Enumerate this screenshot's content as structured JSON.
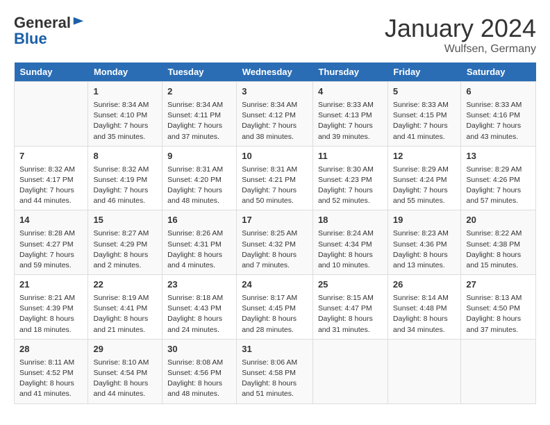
{
  "header": {
    "logo_line1": "General",
    "logo_line2": "Blue",
    "month": "January 2024",
    "location": "Wulfsen, Germany"
  },
  "days_of_week": [
    "Sunday",
    "Monday",
    "Tuesday",
    "Wednesday",
    "Thursday",
    "Friday",
    "Saturday"
  ],
  "weeks": [
    [
      {
        "day": "",
        "info": ""
      },
      {
        "day": "1",
        "info": "Sunrise: 8:34 AM\nSunset: 4:10 PM\nDaylight: 7 hours\nand 35 minutes."
      },
      {
        "day": "2",
        "info": "Sunrise: 8:34 AM\nSunset: 4:11 PM\nDaylight: 7 hours\nand 37 minutes."
      },
      {
        "day": "3",
        "info": "Sunrise: 8:34 AM\nSunset: 4:12 PM\nDaylight: 7 hours\nand 38 minutes."
      },
      {
        "day": "4",
        "info": "Sunrise: 8:33 AM\nSunset: 4:13 PM\nDaylight: 7 hours\nand 39 minutes."
      },
      {
        "day": "5",
        "info": "Sunrise: 8:33 AM\nSunset: 4:15 PM\nDaylight: 7 hours\nand 41 minutes."
      },
      {
        "day": "6",
        "info": "Sunrise: 8:33 AM\nSunset: 4:16 PM\nDaylight: 7 hours\nand 43 minutes."
      }
    ],
    [
      {
        "day": "7",
        "info": "Sunrise: 8:32 AM\nSunset: 4:17 PM\nDaylight: 7 hours\nand 44 minutes."
      },
      {
        "day": "8",
        "info": "Sunrise: 8:32 AM\nSunset: 4:19 PM\nDaylight: 7 hours\nand 46 minutes."
      },
      {
        "day": "9",
        "info": "Sunrise: 8:31 AM\nSunset: 4:20 PM\nDaylight: 7 hours\nand 48 minutes."
      },
      {
        "day": "10",
        "info": "Sunrise: 8:31 AM\nSunset: 4:21 PM\nDaylight: 7 hours\nand 50 minutes."
      },
      {
        "day": "11",
        "info": "Sunrise: 8:30 AM\nSunset: 4:23 PM\nDaylight: 7 hours\nand 52 minutes."
      },
      {
        "day": "12",
        "info": "Sunrise: 8:29 AM\nSunset: 4:24 PM\nDaylight: 7 hours\nand 55 minutes."
      },
      {
        "day": "13",
        "info": "Sunrise: 8:29 AM\nSunset: 4:26 PM\nDaylight: 7 hours\nand 57 minutes."
      }
    ],
    [
      {
        "day": "14",
        "info": "Sunrise: 8:28 AM\nSunset: 4:27 PM\nDaylight: 7 hours\nand 59 minutes."
      },
      {
        "day": "15",
        "info": "Sunrise: 8:27 AM\nSunset: 4:29 PM\nDaylight: 8 hours\nand 2 minutes."
      },
      {
        "day": "16",
        "info": "Sunrise: 8:26 AM\nSunset: 4:31 PM\nDaylight: 8 hours\nand 4 minutes."
      },
      {
        "day": "17",
        "info": "Sunrise: 8:25 AM\nSunset: 4:32 PM\nDaylight: 8 hours\nand 7 minutes."
      },
      {
        "day": "18",
        "info": "Sunrise: 8:24 AM\nSunset: 4:34 PM\nDaylight: 8 hours\nand 10 minutes."
      },
      {
        "day": "19",
        "info": "Sunrise: 8:23 AM\nSunset: 4:36 PM\nDaylight: 8 hours\nand 13 minutes."
      },
      {
        "day": "20",
        "info": "Sunrise: 8:22 AM\nSunset: 4:38 PM\nDaylight: 8 hours\nand 15 minutes."
      }
    ],
    [
      {
        "day": "21",
        "info": "Sunrise: 8:21 AM\nSunset: 4:39 PM\nDaylight: 8 hours\nand 18 minutes."
      },
      {
        "day": "22",
        "info": "Sunrise: 8:19 AM\nSunset: 4:41 PM\nDaylight: 8 hours\nand 21 minutes."
      },
      {
        "day": "23",
        "info": "Sunrise: 8:18 AM\nSunset: 4:43 PM\nDaylight: 8 hours\nand 24 minutes."
      },
      {
        "day": "24",
        "info": "Sunrise: 8:17 AM\nSunset: 4:45 PM\nDaylight: 8 hours\nand 28 minutes."
      },
      {
        "day": "25",
        "info": "Sunrise: 8:15 AM\nSunset: 4:47 PM\nDaylight: 8 hours\nand 31 minutes."
      },
      {
        "day": "26",
        "info": "Sunrise: 8:14 AM\nSunset: 4:48 PM\nDaylight: 8 hours\nand 34 minutes."
      },
      {
        "day": "27",
        "info": "Sunrise: 8:13 AM\nSunset: 4:50 PM\nDaylight: 8 hours\nand 37 minutes."
      }
    ],
    [
      {
        "day": "28",
        "info": "Sunrise: 8:11 AM\nSunset: 4:52 PM\nDaylight: 8 hours\nand 41 minutes."
      },
      {
        "day": "29",
        "info": "Sunrise: 8:10 AM\nSunset: 4:54 PM\nDaylight: 8 hours\nand 44 minutes."
      },
      {
        "day": "30",
        "info": "Sunrise: 8:08 AM\nSunset: 4:56 PM\nDaylight: 8 hours\nand 48 minutes."
      },
      {
        "day": "31",
        "info": "Sunrise: 8:06 AM\nSunset: 4:58 PM\nDaylight: 8 hours\nand 51 minutes."
      },
      {
        "day": "",
        "info": ""
      },
      {
        "day": "",
        "info": ""
      },
      {
        "day": "",
        "info": ""
      }
    ]
  ]
}
